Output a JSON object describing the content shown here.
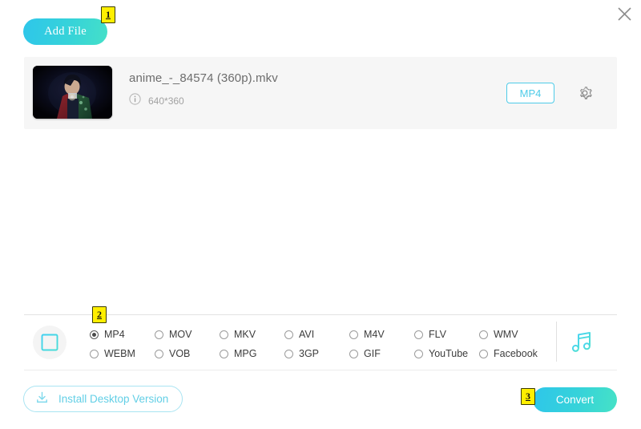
{
  "window": {
    "close_icon": "close-icon"
  },
  "toolbar": {
    "add_file_label": "Add File"
  },
  "badges": [
    {
      "id": "1",
      "label": "1"
    },
    {
      "id": "2",
      "label": "2"
    },
    {
      "id": "3",
      "label": "3"
    }
  ],
  "file": {
    "name": "anime_-_84574 (360p).mkv",
    "resolution": "640*360",
    "info_icon": "info-icon",
    "format_button_label": "MP4",
    "settings_icon": "gear-icon",
    "thumbnail_alt": "anime-video-thumbnail"
  },
  "formats": {
    "video_icon": "film-strip-icon",
    "audio_icon": "music-note-icon",
    "options": [
      {
        "label": "MP4",
        "selected": true
      },
      {
        "label": "MOV",
        "selected": false
      },
      {
        "label": "MKV",
        "selected": false
      },
      {
        "label": "AVI",
        "selected": false
      },
      {
        "label": "M4V",
        "selected": false
      },
      {
        "label": "FLV",
        "selected": false
      },
      {
        "label": "WMV",
        "selected": false
      },
      {
        "label": "WEBM",
        "selected": false
      },
      {
        "label": "VOB",
        "selected": false
      },
      {
        "label": "MPG",
        "selected": false
      },
      {
        "label": "3GP",
        "selected": false
      },
      {
        "label": "GIF",
        "selected": false
      },
      {
        "label": "YouTube",
        "selected": false
      },
      {
        "label": "Facebook",
        "selected": false
      }
    ]
  },
  "footer": {
    "install_label": "Install Desktop Version",
    "install_icon": "download-icon",
    "convert_label": "Convert"
  },
  "colors": {
    "accent_cyan": "#4ecbe8",
    "accent_teal": "#45e0c8",
    "badge_yellow": "#ffef00",
    "row_bg": "#f6f6f6"
  }
}
